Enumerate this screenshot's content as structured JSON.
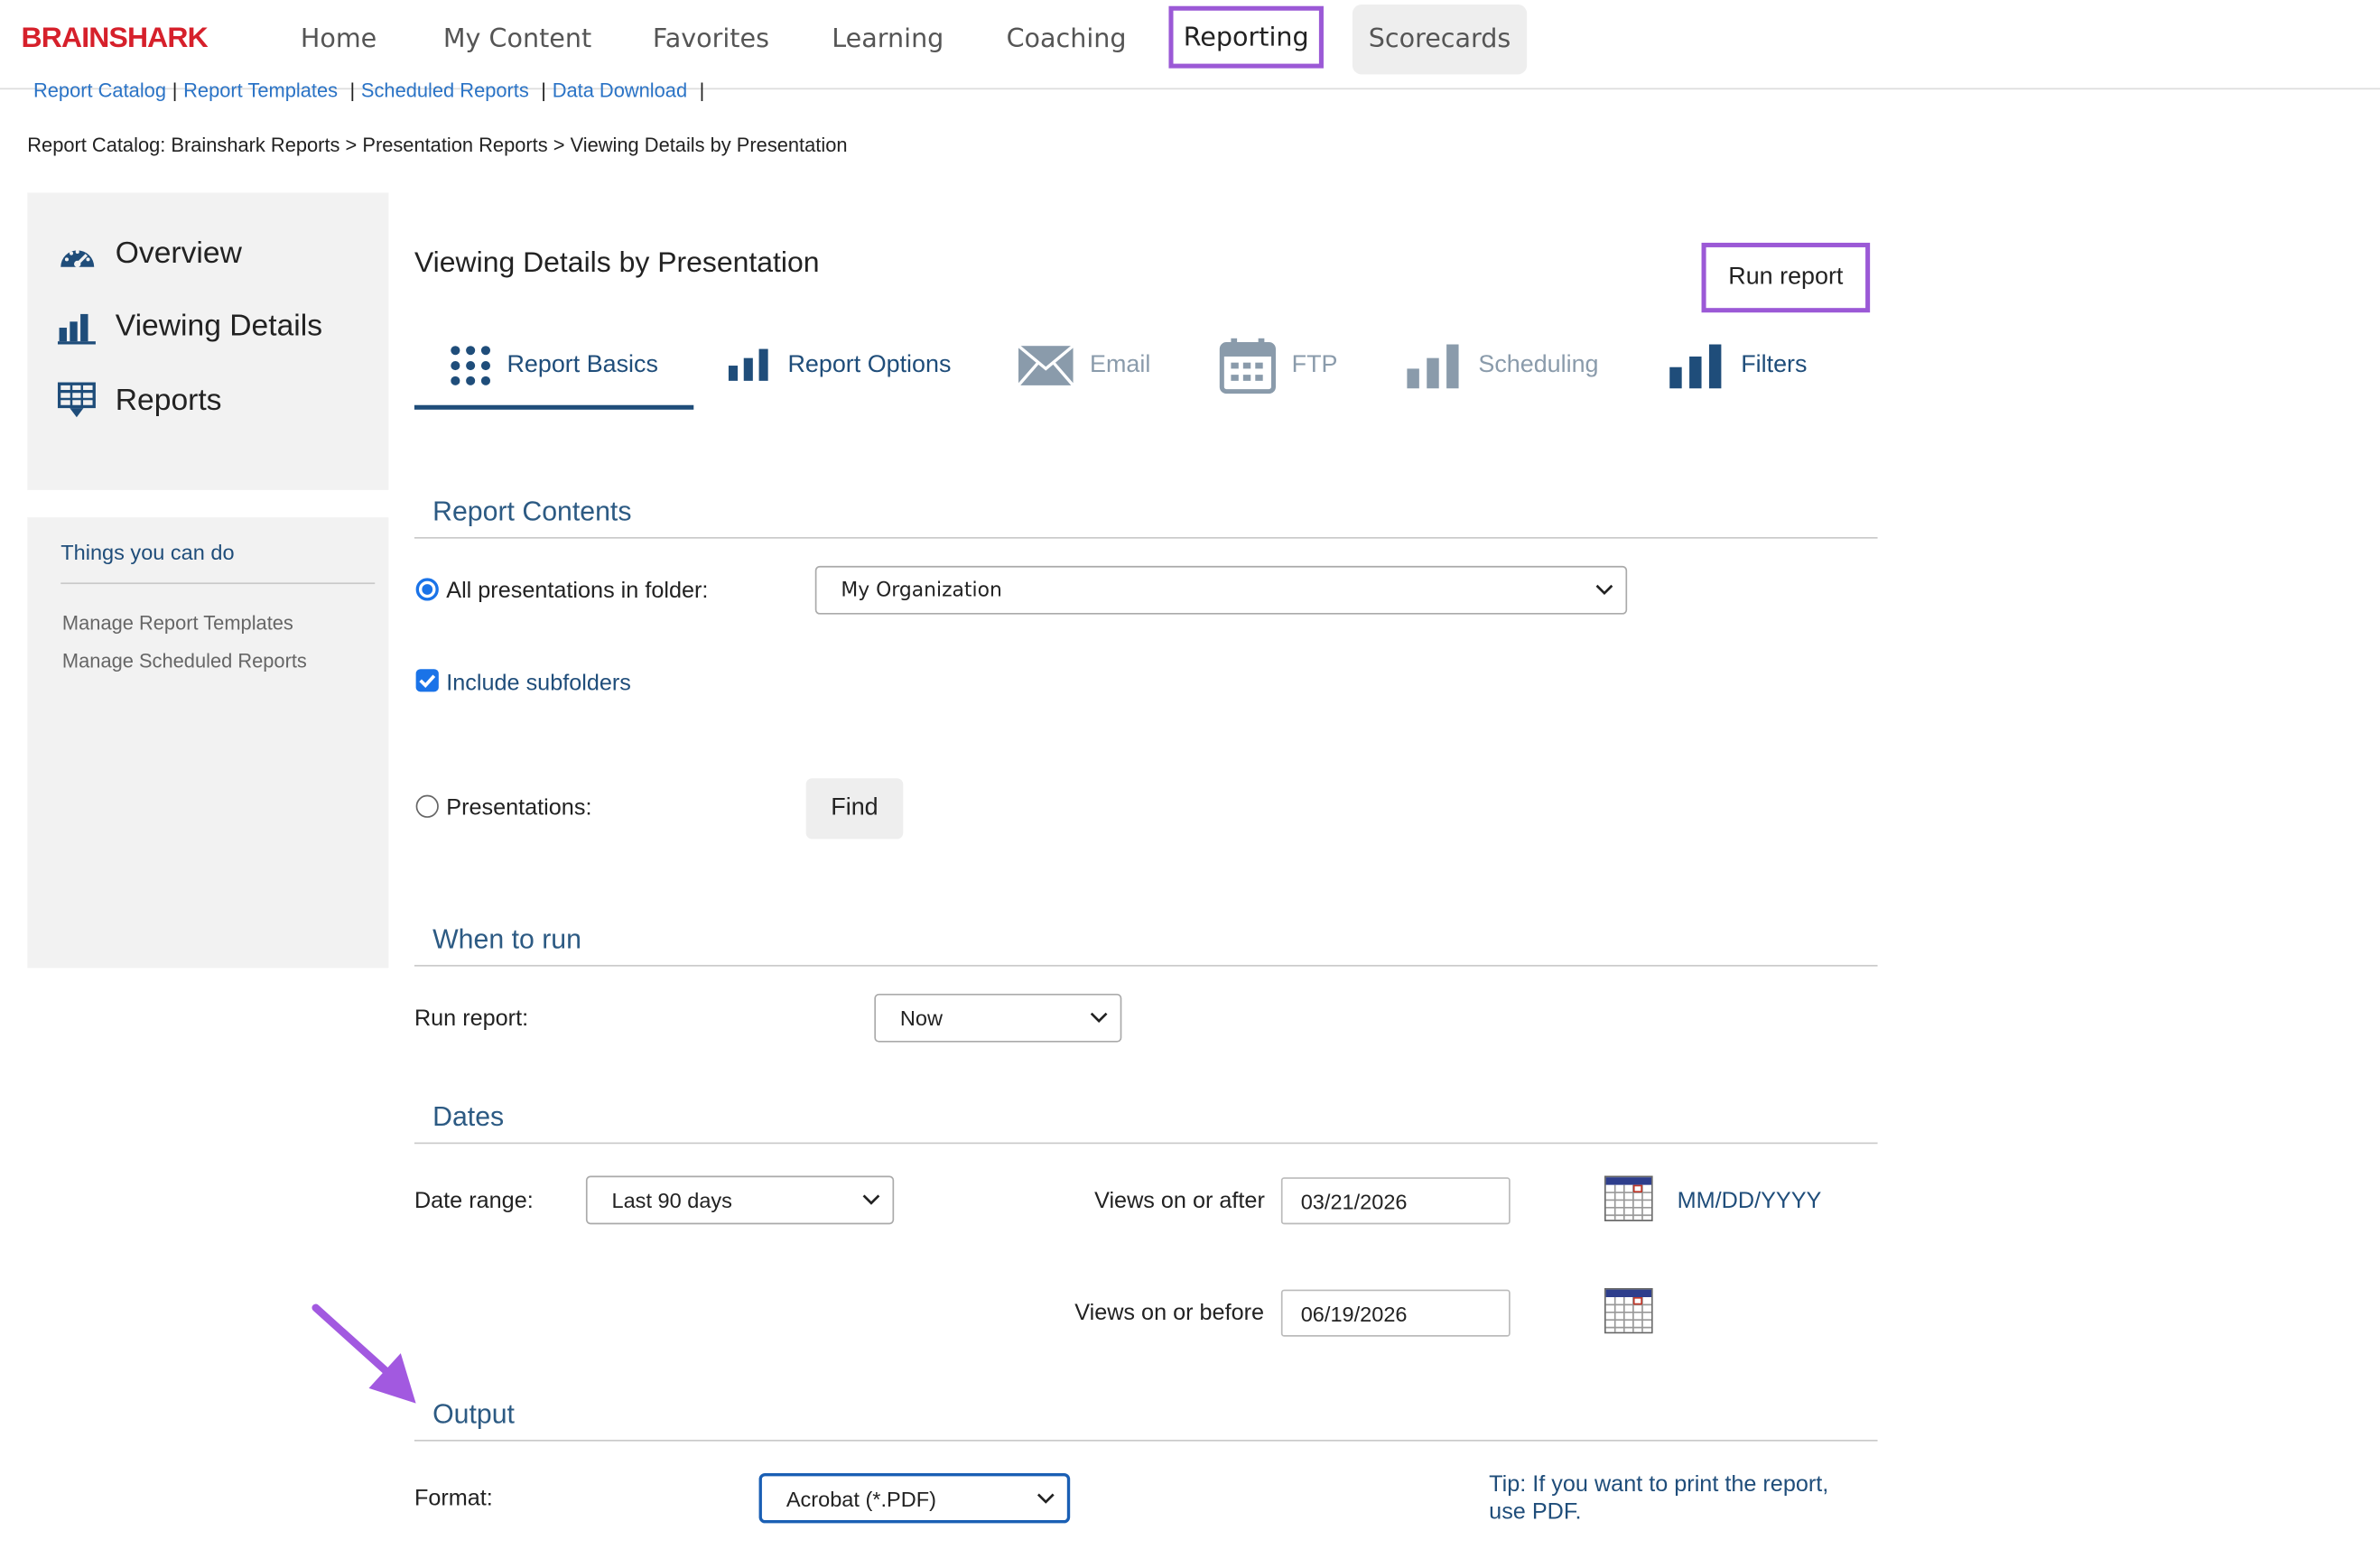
{
  "brand": {
    "logo_text": "BRAINSHARK",
    "brand_color": "#d6202b",
    "highlight_color": "#9b59d6"
  },
  "nav": {
    "items": [
      "Home",
      "My Content",
      "Favorites",
      "Learning",
      "Coaching",
      "Reporting",
      "Scorecards"
    ],
    "active": "Reporting"
  },
  "sublinks": [
    "Report Catalog",
    "Report Templates",
    "Scheduled Reports",
    "Data Download"
  ],
  "breadcrumb": "Report Catalog: Brainshark Reports > Presentation Reports > Viewing Details by Presentation",
  "sidebar": {
    "items": [
      {
        "label": "Overview",
        "icon": "gauge-icon"
      },
      {
        "label": "Viewing Details",
        "icon": "bar-chart-icon"
      },
      {
        "label": "Reports",
        "icon": "table-download-icon"
      }
    ]
  },
  "things": {
    "title": "Things you can do",
    "links": [
      "Manage Report Templates",
      "Manage Scheduled Reports"
    ]
  },
  "page": {
    "title": "Viewing Details by Presentation",
    "run_button": "Run report"
  },
  "tabs": [
    {
      "label": "Report Basics",
      "icon": "dots-grid-icon",
      "active": true
    },
    {
      "label": "Report Options",
      "icon": "bar-chart-icon"
    },
    {
      "label": "Email",
      "icon": "envelope-icon"
    },
    {
      "label": "FTP",
      "icon": "calendar-icon"
    },
    {
      "label": "Scheduling",
      "icon": "bar-chart-icon"
    },
    {
      "label": "Filters",
      "icon": "bar-chart-icon"
    }
  ],
  "report_contents": {
    "title": "Report Contents",
    "all_presentations_label": "All presentations in folder:",
    "all_presentations_checked": true,
    "folder_value": "My Organization",
    "include_subfolders_label": "Include subfolders",
    "include_subfolders_checked": true,
    "presentations_label": "Presentations:",
    "presentations_checked": false,
    "find_button": "Find"
  },
  "when_to_run": {
    "title": "When to run",
    "run_label": "Run report:",
    "run_value": "Now"
  },
  "dates": {
    "title": "Dates",
    "range_label": "Date range:",
    "range_value": "Last 90 days",
    "after_label": "Views on or after",
    "after_value": "03/21/2026",
    "before_label": "Views on or before",
    "before_value": "06/19/2026",
    "format_hint": "MM/DD/YYYY"
  },
  "output": {
    "title": "Output",
    "format_label": "Format:",
    "format_value": "Acrobat (*.PDF)",
    "tip": "Tip: If you want to print the report, use PDF."
  }
}
